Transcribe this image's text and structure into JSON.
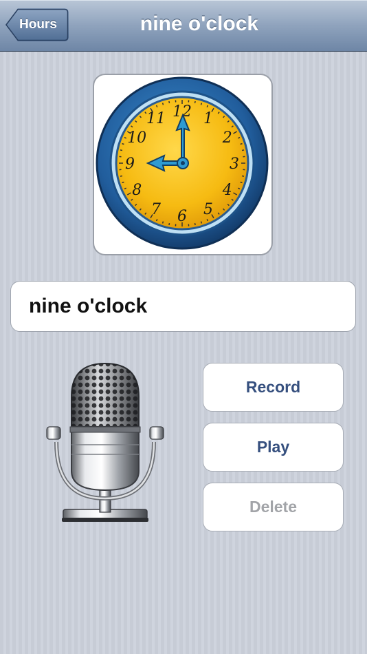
{
  "navbar": {
    "back_label": "Hours",
    "title": "nine o'clock"
  },
  "card": {
    "image_icon": "clock-icon",
    "clock_numerals": [
      "12",
      "1",
      "2",
      "3",
      "4",
      "5",
      "6",
      "7",
      "8",
      "9",
      "10",
      "11"
    ],
    "clock_time": "9:00"
  },
  "title_field": {
    "value": "nine o'clock"
  },
  "recorder": {
    "mic_icon": "microphone-icon",
    "record_label": "Record",
    "play_label": "Play",
    "delete_label": "Delete",
    "delete_enabled": false
  },
  "colors": {
    "navbar": "#8fa3bd",
    "button_text": "#354f7e",
    "disabled_text": "#a2a4a8",
    "clock_face": "#f7c21e",
    "clock_rim": "#2a6fae"
  }
}
